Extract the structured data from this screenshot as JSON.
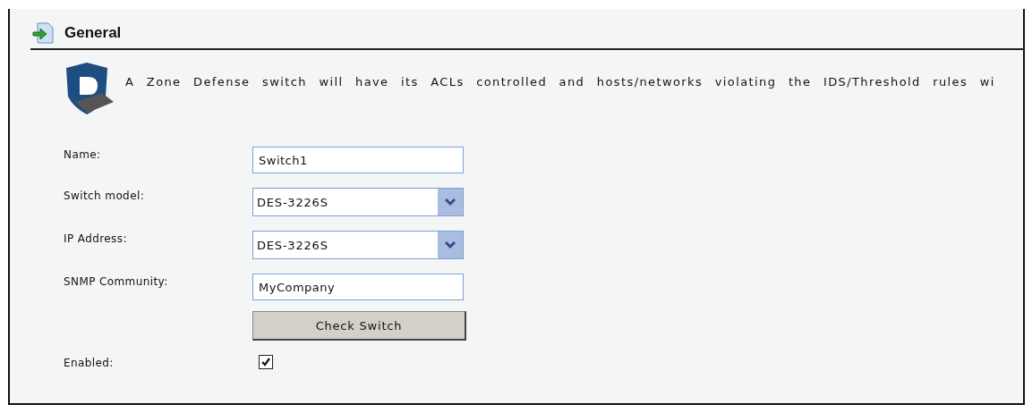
{
  "section": {
    "title": "General"
  },
  "description": "A Zone Defense switch will have its ACLs controlled and hosts/networks violating the IDS/Threshold rules wi",
  "fields": [
    {
      "kind": "text",
      "label": "Name:",
      "value": "Switch1"
    },
    {
      "kind": "select",
      "label": "Switch model:",
      "value": "DES-3226S"
    },
    {
      "kind": "select",
      "label": "IP Address:",
      "value": "DES-3226S"
    },
    {
      "kind": "text",
      "label": "SNMP Community:",
      "value": "MyCompany"
    },
    {
      "kind": "button",
      "label": "Check Switch"
    },
    {
      "kind": "checkbox",
      "label": "Enabled:",
      "checked": true
    }
  ]
}
